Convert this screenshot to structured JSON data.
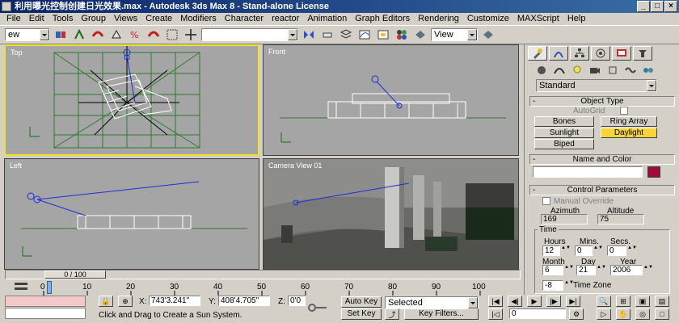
{
  "window": {
    "title": "利用曝光控制创建日光效果.max - Autodesk 3ds Max 8 - Stand-alone License",
    "buttons": [
      "_",
      "□",
      "×"
    ]
  },
  "menu": [
    "File",
    "Edit",
    "Tools",
    "Group",
    "Views",
    "Create",
    "Modifiers",
    "Character",
    "reactor",
    "Animation",
    "Graph Editors",
    "Rendering",
    "Customize",
    "MAXScript",
    "Help"
  ],
  "toolbar": {
    "selection_filter": "ew",
    "named_selection": "",
    "view_dropdown": "View",
    "icons": [
      "select-link-icon",
      "unlink-icon",
      "bind-spacewarp-icon",
      "select-icon",
      "select-by-name-icon",
      "select-region-icon",
      "window-crossing-icon",
      "move-icon",
      "rotate-icon",
      "scale-icon",
      "reference-coord-icon",
      "pivot-icon",
      "mirror-icon",
      "align-icon",
      "layer-icon",
      "curve-editor-icon",
      "schematic-icon",
      "material-editor-icon",
      "render-scene-icon",
      "quick-render-icon"
    ]
  },
  "viewports": [
    {
      "label": "Top",
      "active": true
    },
    {
      "label": "Front",
      "active": false
    },
    {
      "label": "Left",
      "active": false
    },
    {
      "label": "Camera View 01",
      "active": false
    }
  ],
  "command_panel": {
    "tabs": [
      "create-tab",
      "modify-tab",
      "hierarchy-tab",
      "motion-tab",
      "display-tab",
      "utilities-tab"
    ],
    "categories": [
      "geometry-icon",
      "shapes-icon",
      "lights-icon",
      "cameras-icon",
      "helpers-icon",
      "spacewarps-icon",
      "systems-icon"
    ],
    "subcategory": "Standard",
    "object_type": {
      "header": "Object Type",
      "autogrid": "AutoGrid",
      "buttons": [
        "Bones",
        "Ring Array",
        "Sunlight",
        "Daylight",
        "Biped"
      ],
      "active_button": "Daylight"
    },
    "name_color": {
      "header": "Name and Color",
      "name_value": "",
      "swatch_color": "#9e0b3c"
    },
    "control_params": {
      "header": "Control Parameters",
      "manual_override": "Manual Override",
      "azimuth_label": "Azimuth",
      "azimuth_value": "169",
      "altitude_label": "Altitude",
      "altitude_value": "75",
      "time_label": "Time",
      "hours_label": "Hours",
      "mins_label": "Mins.",
      "secs_label": "Secs.",
      "hours_value": "12",
      "mins_value": "0",
      "secs_value": "0",
      "month_label": "Month",
      "day_label": "Day",
      "year_label": "Year",
      "month_value": "6",
      "day_value": "21",
      "year_value": "2006",
      "timezone_value": "-8",
      "timezone_label": "Time Zone"
    }
  },
  "timeline": {
    "slider_text": "0 / 100",
    "ticks": [
      "0",
      "10",
      "20",
      "30",
      "40",
      "50",
      "60",
      "70",
      "80",
      "90",
      "100"
    ]
  },
  "status": {
    "x_label": "X:",
    "x_value": "743'3.241\"",
    "y_label": "Y:",
    "y_value": "408'4.705\"",
    "z_label": "Z:",
    "z_value": "0'0",
    "prompt": "Click and Drag to Create a Sun System.",
    "auto_key": "Auto Key",
    "set_key": "Set Key",
    "selected": "Selected",
    "key_filters": "Key Filters...",
    "frame_value": "0"
  },
  "colors": {
    "viewport_bg": "#a5a5a5",
    "active_border": "#f0e030",
    "swatch": "#9e0b3c",
    "daylight_button": "#f5d53a",
    "grid_green": "#2f7a2f",
    "sun_blue": "#1a2fd8"
  }
}
